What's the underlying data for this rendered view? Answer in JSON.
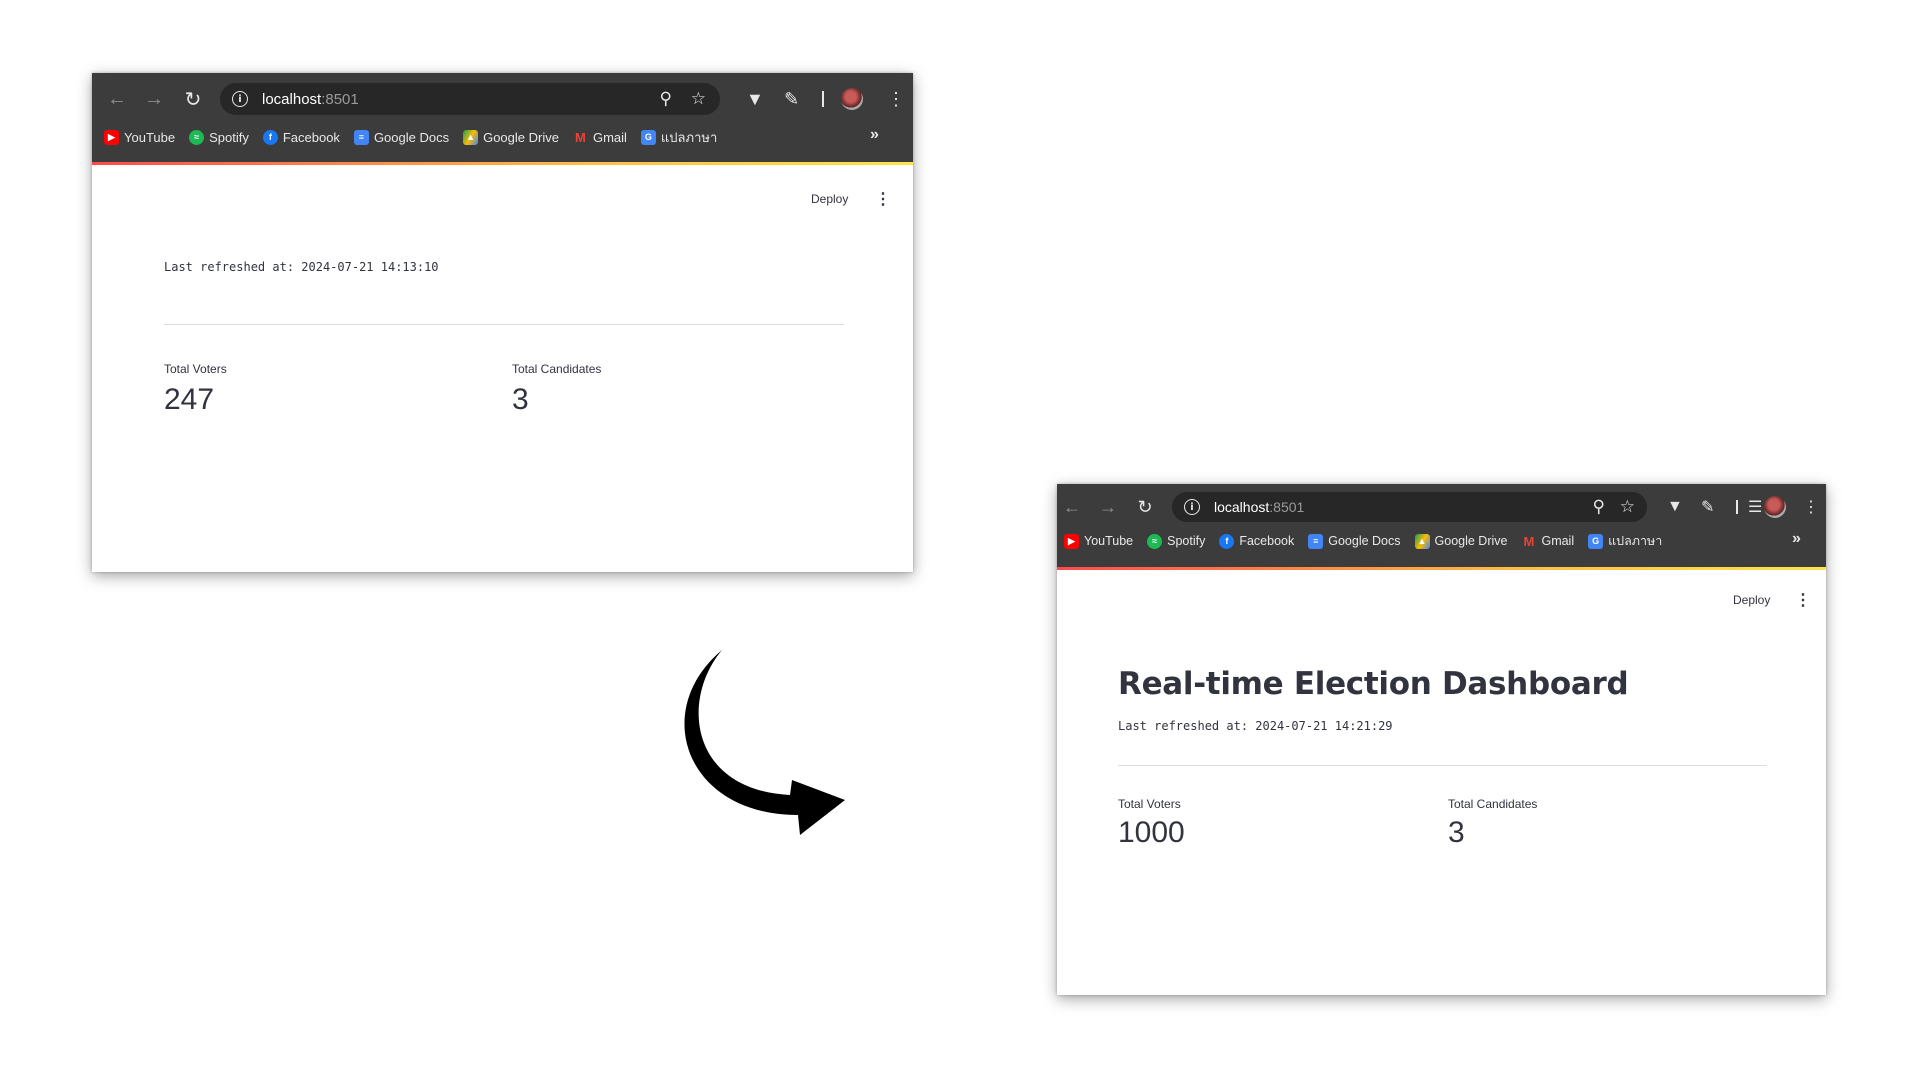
{
  "bookmarks": [
    {
      "label": "YouTube",
      "icon": "youtube-icon",
      "color": "#ff0000"
    },
    {
      "label": "Spotify",
      "icon": "spotify-icon",
      "color": "#1db954"
    },
    {
      "label": "Facebook",
      "icon": "facebook-icon",
      "color": "#1877f2"
    },
    {
      "label": "Google Docs",
      "icon": "google-docs-icon",
      "color": "#4285f4"
    },
    {
      "label": "Google Drive",
      "icon": "google-drive-icon",
      "color": "#fbbc04"
    },
    {
      "label": "Gmail",
      "icon": "gmail-icon",
      "color": "#ea4335"
    },
    {
      "label": "แปลภาษา",
      "icon": "google-translate-icon",
      "color": "#4285f4"
    }
  ],
  "before": {
    "url_host": "localhost",
    "url_port": ":8501",
    "deploy_label": "Deploy",
    "last_refreshed": "Last refreshed at: 2024-07-21 14:13:10",
    "metrics": [
      {
        "label": "Total Voters",
        "value": "247"
      },
      {
        "label": "Total Candidates",
        "value": "3"
      }
    ]
  },
  "after": {
    "url_host": "localhost",
    "url_port": ":8501",
    "deploy_label": "Deploy",
    "page_title": "Real-time Election Dashboard",
    "last_refreshed": "Last refreshed at: 2024-07-21 14:21:29",
    "metrics": [
      {
        "label": "Total Voters",
        "value": "1000"
      },
      {
        "label": "Total Candidates",
        "value": "3"
      }
    ]
  },
  "colors": {
    "chrome_bg": "#3c3c3c",
    "omnibox_bg": "#272727",
    "streamlit_text": "#31333f",
    "accent_red": "#ff4b4b",
    "accent_yellow": "#ffe44d"
  }
}
